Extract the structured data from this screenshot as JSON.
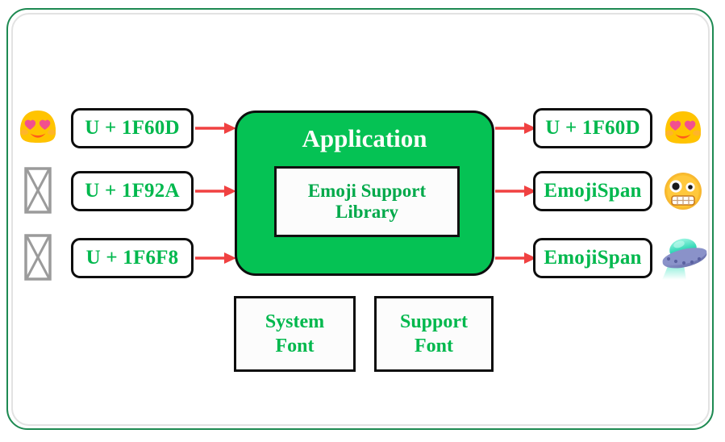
{
  "diagram": {
    "title": "Emoji Support Library flow",
    "colors": {
      "frame_green": "#1e8a52",
      "frame_gray": "#e2e2e2",
      "box_border": "#0d0d0d",
      "text_green": "#00b84d",
      "app_fill": "#05c254",
      "app_title_color": "#ffffff",
      "arrow_red": "#f04141",
      "tofu_gray": "#9b9b9b"
    },
    "input_column": {
      "glyphs": [
        {
          "name": "heart-eyes-emoji-glyph",
          "kind": "emoji",
          "char": "😍",
          "label": "smiling face with heart-eyes"
        },
        {
          "name": "missing-glyph-tofu-1f92a",
          "kind": "tofu",
          "char": "☒",
          "label": "missing glyph box"
        },
        {
          "name": "missing-glyph-tofu-1f6f8",
          "kind": "tofu",
          "char": "☒",
          "label": "missing glyph box"
        }
      ],
      "codes": [
        {
          "label": "U + 1F60D"
        },
        {
          "label": "U + 1F92A"
        },
        {
          "label": "U + 1F6F8"
        }
      ]
    },
    "application": {
      "title": "Application",
      "library_label": "Emoji Support\nLibrary",
      "library_line1": "Emoji Support",
      "library_line2": "Library"
    },
    "output_column": {
      "codes": [
        {
          "label": "U + 1F60D"
        },
        {
          "label": "EmojiSpan"
        },
        {
          "label": "EmojiSpan"
        }
      ],
      "glyphs": [
        {
          "name": "heart-eyes-emoji-glyph",
          "kind": "emoji",
          "char": "😍",
          "label": "smiling face with heart-eyes"
        },
        {
          "name": "zany-face-emoji-glyph",
          "kind": "emoji",
          "char": "🤪",
          "label": "zany face"
        },
        {
          "name": "flying-saucer-emoji-glyph",
          "kind": "emoji",
          "char": "🛸",
          "label": "flying saucer"
        }
      ]
    },
    "font_boxes": [
      {
        "line1": "System",
        "line2": "Font"
      },
      {
        "line1": "Support",
        "line2": "Font"
      }
    ],
    "arrows": {
      "count": 6,
      "direction": "left-to-right",
      "color": "#f04141"
    }
  }
}
